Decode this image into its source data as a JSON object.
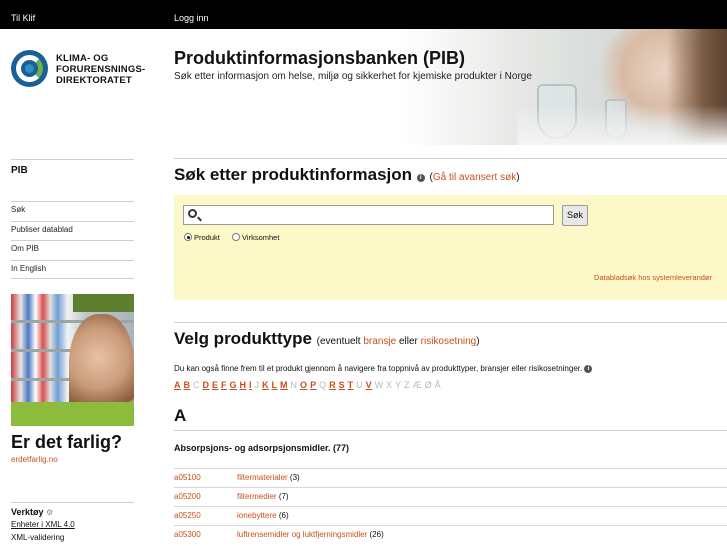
{
  "topbar": {
    "home_link": "Til Klif",
    "login_link": "Logg inn"
  },
  "logo": {
    "line1": "KLIMA- OG",
    "line2": "FORURENSNINGS-",
    "line3": "DIREKTORATET"
  },
  "header": {
    "title": "Produktinformasjonsbanken (PIB)",
    "subtitle": "Søk etter informasjon om helse, miljø og sikkerhet for kjemiske produkter i Norge"
  },
  "sidebar": {
    "heading": "PIB",
    "items": [
      {
        "label": "Søk"
      },
      {
        "label": "Publiser datablad"
      },
      {
        "label": "Om PIB"
      },
      {
        "label": "In English"
      }
    ]
  },
  "promo": {
    "question": "Er det farlig?",
    "link": "erdetfarlig.no"
  },
  "tools": {
    "heading": "Verktøy",
    "items": [
      {
        "label": "Enheter i XML 4.0"
      },
      {
        "label": "XML-validering"
      }
    ]
  },
  "search": {
    "heading": "Søk etter produktinformasjon",
    "advanced_open": "(",
    "advanced_link": "Gå til avansert søk",
    "advanced_close": ")",
    "input_value": "",
    "button_label": "Søk",
    "radio_product": "Produkt",
    "radio_company": "Virksomhet",
    "selected": "Produkt",
    "datasheet_link": "Databladsøk hos systemleverandør"
  },
  "product_type": {
    "heading": "Velg produkttype",
    "aside_pre": "(eventuelt",
    "link_industry": "bransje",
    "aside_mid": "eller",
    "link_risk": "risikosetning",
    "aside_post": ")",
    "description": "Du kan også finne frem til et produkt gjennom å navigere fra toppnivå av produkttyper, bransjer eller risikosetninger.",
    "alphabet": [
      {
        "l": "A",
        "active": true
      },
      {
        "l": "B",
        "active": true
      },
      {
        "l": "C",
        "active": false
      },
      {
        "l": "D",
        "active": true
      },
      {
        "l": "E",
        "active": true
      },
      {
        "l": "F",
        "active": true
      },
      {
        "l": "G",
        "active": true
      },
      {
        "l": "H",
        "active": true
      },
      {
        "l": "I",
        "active": true
      },
      {
        "l": "J",
        "active": false
      },
      {
        "l": "K",
        "active": true
      },
      {
        "l": "L",
        "active": true
      },
      {
        "l": "M",
        "active": true
      },
      {
        "l": "N",
        "active": false
      },
      {
        "l": "O",
        "active": true
      },
      {
        "l": "P",
        "active": true
      },
      {
        "l": "Q",
        "active": false
      },
      {
        "l": "R",
        "active": true
      },
      {
        "l": "S",
        "active": true
      },
      {
        "l": "T",
        "active": true
      },
      {
        "l": "U",
        "active": false
      },
      {
        "l": "V",
        "active": true
      },
      {
        "l": "W",
        "active": false
      },
      {
        "l": "X",
        "active": false
      },
      {
        "l": "Y",
        "active": false
      },
      {
        "l": "Z",
        "active": false
      },
      {
        "l": "Æ",
        "active": false
      },
      {
        "l": "Ø",
        "active": false
      },
      {
        "l": "Å",
        "active": false
      }
    ],
    "current_letter": "A",
    "group_title": "Absorpsjons- og adsorpsjonsmidler. (77)",
    "rows": [
      {
        "code": "a05100",
        "name": "filtermaterialer",
        "count": "(3)"
      },
      {
        "code": "a05200",
        "name": "filtermedier",
        "count": "(7)"
      },
      {
        "code": "a05250",
        "name": "ionebyttere",
        "count": "(6)"
      },
      {
        "code": "a05300",
        "name": "luftrensemidler og luktfjerningsmidler",
        "count": "(26)"
      }
    ]
  },
  "colors": {
    "accent": "#c8501e",
    "search_bg": "#fcf8c8",
    "topbar_bg": "#000000"
  }
}
